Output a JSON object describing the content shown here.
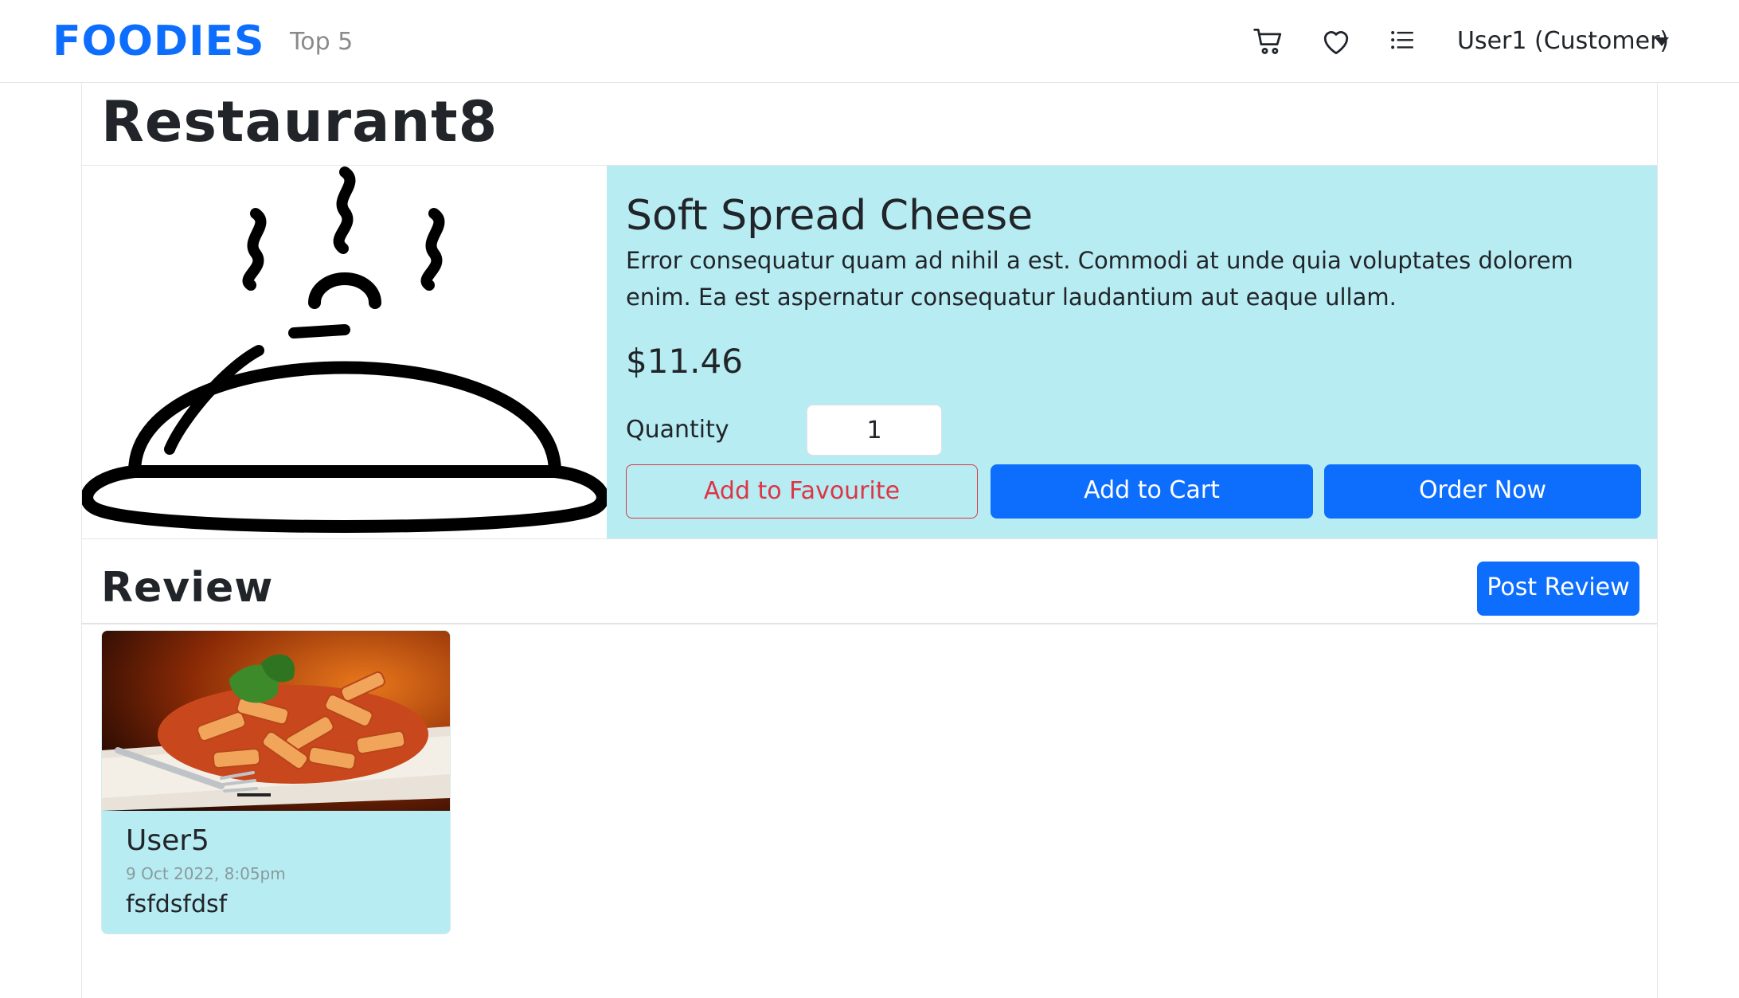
{
  "navbar": {
    "brand": "FOODIES",
    "top_link": "Top 5",
    "user_menu": "User1 (Customer)",
    "icons": [
      "cart-icon",
      "heart-icon",
      "list-icon",
      "caret-down-icon"
    ]
  },
  "restaurant": {
    "name": "Restaurant8"
  },
  "product": {
    "name": "Soft Spread Cheese",
    "description": "Error consequatur quam ad nihil a est. Commodi at unde quia voluptates dolorem enim. Ea est aspernatur consequatur laudantium aut eaque ullam.",
    "price": "$11.46",
    "quantity_label": "Quantity",
    "quantity_value": "1",
    "favourite_label": "Add to Favourite",
    "cart_label": "Add to Cart",
    "order_label": "Order Now"
  },
  "reviews": {
    "title": "Review",
    "post_label": "Post Review",
    "items": [
      {
        "user": "User5",
        "date": "9 Oct 2022, 8:05pm",
        "text": "fsfdsfdsf"
      }
    ]
  },
  "colors": {
    "primary": "#0d6efd",
    "danger": "#dc3545",
    "panel": "#b7ecf3"
  }
}
